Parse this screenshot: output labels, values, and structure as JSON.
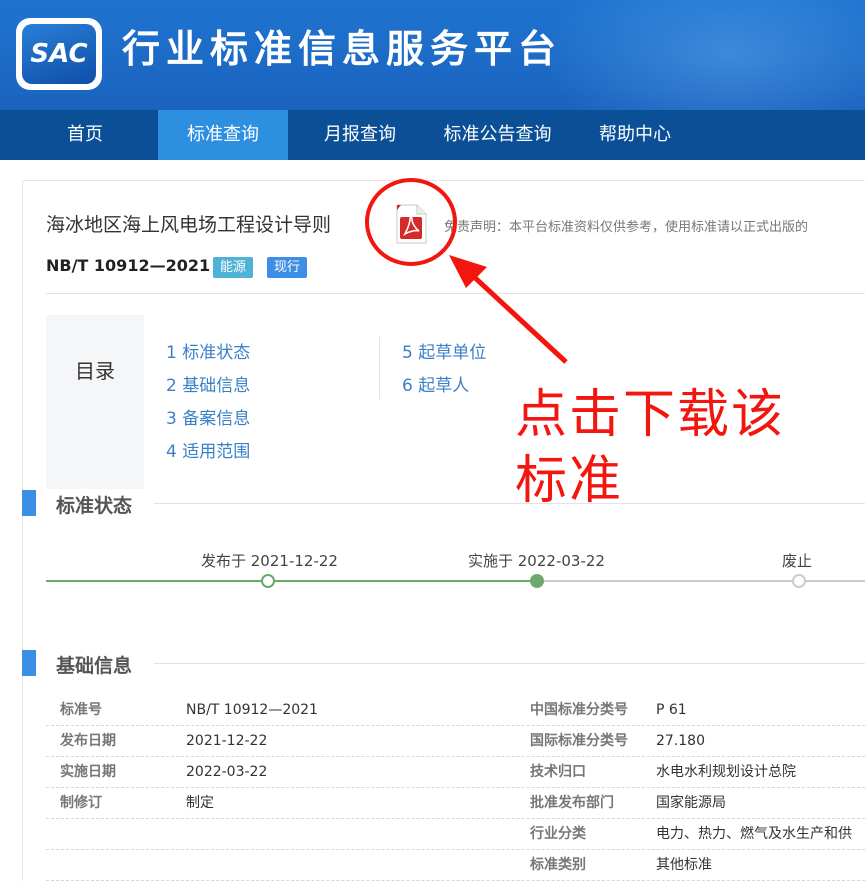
{
  "header": {
    "logo_text": "SAC",
    "site_title": "行业标准信息服务平台"
  },
  "nav": {
    "items": [
      {
        "label": "首页",
        "active": false
      },
      {
        "label": "标准查询",
        "active": true
      },
      {
        "label": "月报查询",
        "active": false
      },
      {
        "label": "标准公告查询",
        "active": false
      },
      {
        "label": "帮助中心",
        "active": false
      }
    ]
  },
  "standard": {
    "title": "海冰地区海上风电场工程设计导则",
    "code": "NB/T 10912—2021",
    "tags": [
      "能源",
      "现行"
    ],
    "disclaimer": "免责声明：本平台标准资料仅供参考，使用标准请以正式出版的"
  },
  "annotation": {
    "text_line1": "点击下载该",
    "text_line2": "标准",
    "color": "#f2160f"
  },
  "toc": {
    "label": "目录",
    "items": [
      "1  标准状态",
      "2  基础信息",
      "3  备案信息",
      "4  适用范围",
      "5  起草单位",
      "6  起草人"
    ]
  },
  "sections": {
    "status_title": "标准状态",
    "basic_title": "基础信息"
  },
  "timeline": {
    "published": "发布于 2021-12-22",
    "implemented": "实施于 2022-03-22",
    "abolished": "废止",
    "active_color": "#6fa86b",
    "inactive_color": "#cccccc"
  },
  "basic_info": {
    "left": [
      {
        "key": "标准号",
        "value": "NB/T 10912—2021"
      },
      {
        "key": "发布日期",
        "value": "2021-12-22"
      },
      {
        "key": "实施日期",
        "value": "2022-03-22"
      },
      {
        "key": "制修订",
        "value": "制定"
      }
    ],
    "right": [
      {
        "key": "中国标准分类号",
        "value": "P 61"
      },
      {
        "key": "国际标准分类号",
        "value": "27.180"
      },
      {
        "key": "技术归口",
        "value": "水电水利规划设计总院"
      },
      {
        "key": "批准发布部门",
        "value": "国家能源局"
      },
      {
        "key": "行业分类",
        "value": "电力、热力、燃气及水生产和供"
      },
      {
        "key": "标准类别",
        "value": "其他标准"
      }
    ]
  }
}
